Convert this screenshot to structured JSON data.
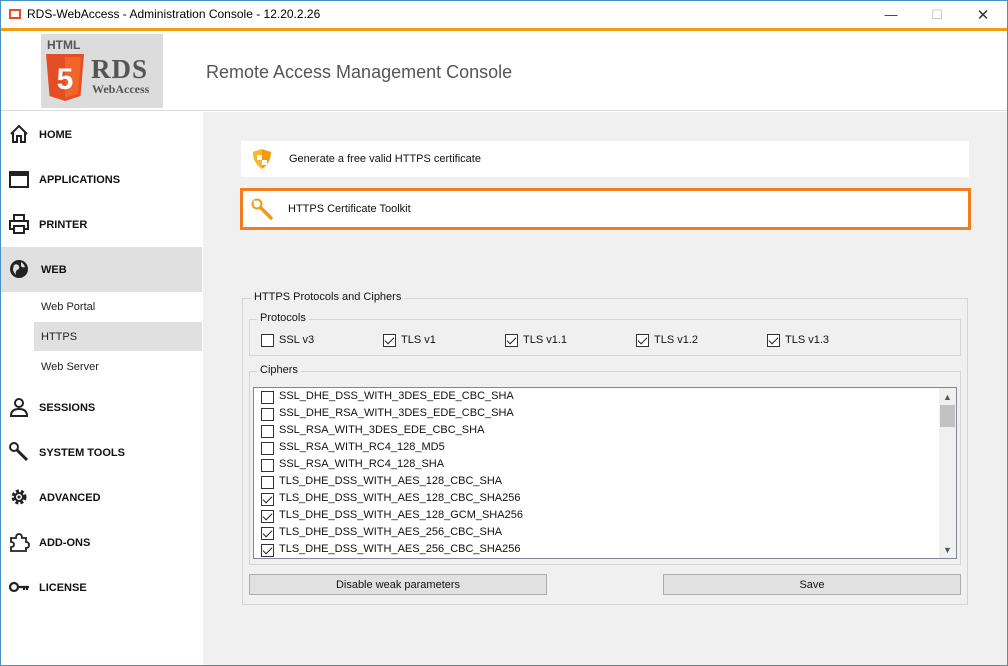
{
  "window": {
    "title": "RDS-WebAccess - Administration Console - 12.20.2.26",
    "minimize_glyph": "—",
    "maximize_glyph": "☐",
    "close_glyph": "✕"
  },
  "header": {
    "logo_html": "HTML",
    "logo_five": "5",
    "logo_rds": "RDS",
    "logo_webaccess": "WebAccess",
    "console_title": "Remote Access Management Console"
  },
  "sidebar": {
    "items": [
      {
        "label": "HOME",
        "icon": "home-icon"
      },
      {
        "label": "APPLICATIONS",
        "icon": "window-icon"
      },
      {
        "label": "PRINTER",
        "icon": "printer-icon"
      },
      {
        "label": "WEB",
        "icon": "globe-icon"
      },
      {
        "label": "SESSIONS",
        "icon": "user-icon"
      },
      {
        "label": "SYSTEM TOOLS",
        "icon": "tools-icon"
      },
      {
        "label": "ADVANCED",
        "icon": "gear-icon"
      },
      {
        "label": "ADD-ONS",
        "icon": "puzzle-icon"
      },
      {
        "label": "LICENSE",
        "icon": "key-icon"
      }
    ],
    "web_subitems": [
      {
        "label": "Web Portal"
      },
      {
        "label": "HTTPS"
      },
      {
        "label": "Web Server"
      }
    ],
    "active_item": "WEB",
    "active_subitem": "HTTPS"
  },
  "main": {
    "actions": [
      {
        "label": "Generate a free valid HTTPS certificate",
        "icon": "shield-icon"
      },
      {
        "label": "HTTPS Certificate Toolkit",
        "icon": "wrench-icon"
      }
    ],
    "protocols_group_title": "HTTPS Protocols and Ciphers",
    "protocols_title": "Protocols",
    "protocols": [
      {
        "label": "SSL v3",
        "checked": false
      },
      {
        "label": "TLS v1",
        "checked": true
      },
      {
        "label": "TLS v1.1",
        "checked": true
      },
      {
        "label": "TLS v1.2",
        "checked": true
      },
      {
        "label": "TLS v1.3",
        "checked": true
      }
    ],
    "ciphers_title": "Ciphers",
    "ciphers": [
      {
        "label": "SSL_DHE_DSS_WITH_3DES_EDE_CBC_SHA",
        "checked": false
      },
      {
        "label": "SSL_DHE_RSA_WITH_3DES_EDE_CBC_SHA",
        "checked": false
      },
      {
        "label": "SSL_RSA_WITH_3DES_EDE_CBC_SHA",
        "checked": false
      },
      {
        "label": "SSL_RSA_WITH_RC4_128_MD5",
        "checked": false
      },
      {
        "label": "SSL_RSA_WITH_RC4_128_SHA",
        "checked": false
      },
      {
        "label": "TLS_DHE_DSS_WITH_AES_128_CBC_SHA",
        "checked": false
      },
      {
        "label": "TLS_DHE_DSS_WITH_AES_128_CBC_SHA256",
        "checked": true
      },
      {
        "label": "TLS_DHE_DSS_WITH_AES_128_GCM_SHA256",
        "checked": true
      },
      {
        "label": "TLS_DHE_DSS_WITH_AES_256_CBC_SHA",
        "checked": true
      },
      {
        "label": "TLS_DHE_DSS_WITH_AES_256_CBC_SHA256",
        "checked": true
      }
    ],
    "disable_weak_label": "Disable weak parameters",
    "save_label": "Save"
  },
  "colors": {
    "accent": "#f39c12",
    "highlight_border": "#f47c20",
    "logo_orange": "#e44d26"
  }
}
